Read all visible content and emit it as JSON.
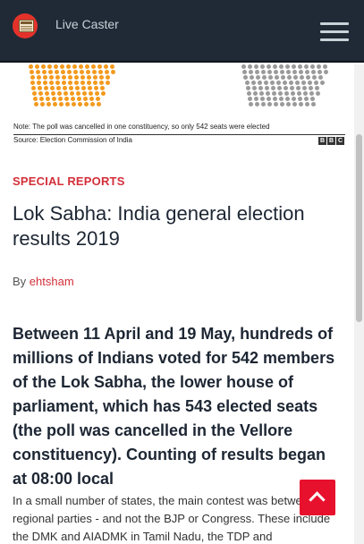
{
  "header": {
    "brand": "Live Caster",
    "logo_icon": "newspaper-icon",
    "menu_icon": "hamburger-menu-icon"
  },
  "infographic": {
    "note": "Note: The poll was cancelled in one constituency, so only 542 seats were elected",
    "source": "Source: Election Commission of India",
    "logo_letters": [
      "B",
      "B",
      "C"
    ],
    "colors": {
      "left_dots": "#f39a1e",
      "right_dots": "#9a9a9a"
    }
  },
  "article": {
    "category": "SPECIAL REPORTS",
    "title": "Lok Sabha: India general election results 2019",
    "byline_prefix": "By ",
    "author": "ehtsham",
    "lead": "Between 11 April and 19 May, hundreds of millions of Indians voted for 542 members of the Lok Sabha, the lower house of parliament, which has 543 elected seats (the poll was cancelled in the Vellore constituency). Counting of results began at 08:00 local",
    "body": "In a small number of states, the main contest was between regional parties - and not the BJP or Congress. These include the DMK and AIADMK in Tamil Nadu, the TDP and"
  },
  "scroll_top_icon": "chevron-up-icon",
  "colors": {
    "accent": "#d32f3a",
    "header_bg": "#1f2a36",
    "button": "#e8112d"
  }
}
